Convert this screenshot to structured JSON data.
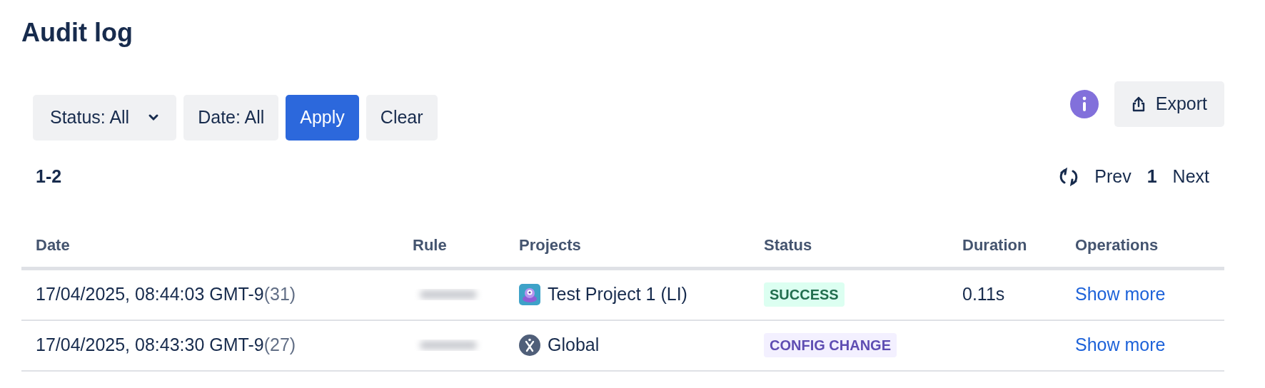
{
  "title": "Audit log",
  "filters": [
    {
      "label": "Status: All",
      "kind": "dropdown",
      "primary": false
    },
    {
      "label": "Date: All",
      "kind": "button",
      "primary": false
    },
    {
      "label": "Apply",
      "kind": "button",
      "primary": true
    },
    {
      "label": "Clear",
      "kind": "button",
      "primary": false
    }
  ],
  "export": {
    "label": "Export"
  },
  "range": "1-2",
  "pagination": {
    "prev": "Prev",
    "page": "1",
    "next": "Next"
  },
  "table": {
    "columns": [
      "Date",
      "Rule",
      "Projects",
      "Status",
      "Duration",
      "Operations"
    ],
    "rows": [
      {
        "date": "17/04/2025, 08:44:03 GMT-9",
        "count": "(31)",
        "project": {
          "kind": "project",
          "name": "Test Project 1 (LI)"
        },
        "status": {
          "label": "SUCCESS",
          "kind": "success"
        },
        "duration": "0.11s",
        "operation": "Show more"
      },
      {
        "date": "17/04/2025, 08:43:30 GMT-9",
        "count": "(27)",
        "project": {
          "kind": "global",
          "name": "Global"
        },
        "status": {
          "label": "CONFIG CHANGE",
          "kind": "config"
        },
        "operation": "Show more"
      }
    ]
  }
}
